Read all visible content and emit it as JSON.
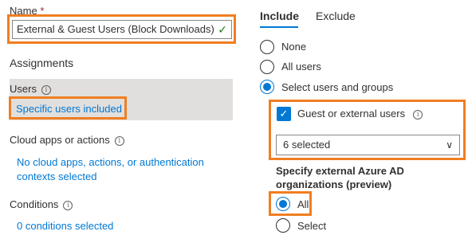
{
  "name_field": {
    "label": "Name",
    "required_mark": "*",
    "value": "External & Guest Users (Block Downloads)",
    "valid_icon": "checkmark-icon"
  },
  "assignments": {
    "heading": "Assignments",
    "users": {
      "title": "Users",
      "value": "Specific users included"
    },
    "cloud_apps": {
      "title": "Cloud apps or actions",
      "value": "No cloud apps, actions, or authentication contexts selected"
    },
    "conditions": {
      "title": "Conditions",
      "value": "0 conditions selected"
    }
  },
  "tabs": {
    "include": "Include",
    "exclude": "Exclude"
  },
  "include_options": {
    "none": "None",
    "all_users": "All users",
    "select_users": "Select users and groups"
  },
  "guest_checkbox": {
    "label": "Guest or external users",
    "checked": true
  },
  "guest_select": {
    "value": "6 selected"
  },
  "external_orgs": {
    "heading": "Specify external Azure AD organizations (preview)",
    "all": "All",
    "select": "Select"
  },
  "colors": {
    "accent": "#0078d4",
    "highlight": "#f07e22",
    "panel": "#e1dfdd"
  }
}
